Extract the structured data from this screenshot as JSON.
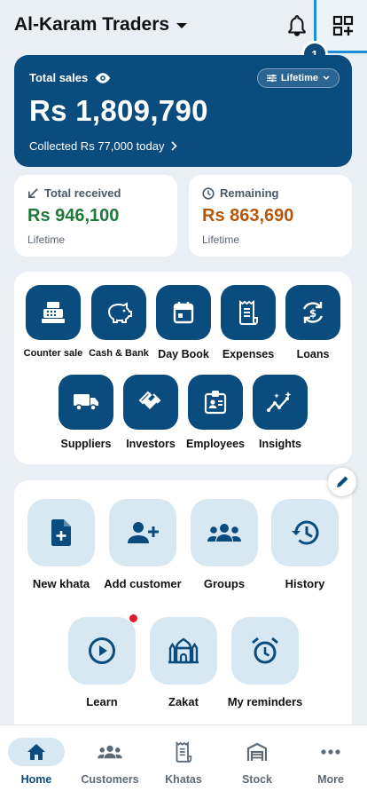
{
  "header": {
    "business_name": "Al-Karam Traders",
    "qr_badge_count": "1"
  },
  "sales": {
    "label": "Total sales",
    "period": "Lifetime",
    "amount": "Rs 1,809,790",
    "collected": "Collected Rs 77,000 today"
  },
  "stats": {
    "received": {
      "title": "Total received",
      "value": "Rs 946,100",
      "sub": "Lifetime",
      "color": "#1f7a3a"
    },
    "remaining": {
      "title": "Remaining",
      "value": "Rs 863,690",
      "sub": "Lifetime",
      "color": "#b5560b"
    }
  },
  "tools": [
    {
      "label": "Counter sale",
      "icon": "cash-register-icon"
    },
    {
      "label": "Cash & Bank",
      "icon": "piggy-bank-icon"
    },
    {
      "label": "Day Book",
      "icon": "calendar-icon"
    },
    {
      "label": "Expenses",
      "icon": "receipt-icon"
    },
    {
      "label": "Loans",
      "icon": "loan-icon"
    },
    {
      "label": "Suppliers",
      "icon": "truck-icon"
    },
    {
      "label": "Investors",
      "icon": "handshake-icon"
    },
    {
      "label": "Employees",
      "icon": "id-badge-icon"
    },
    {
      "label": "Insights",
      "icon": "insights-icon"
    }
  ],
  "actions": [
    {
      "label": "New khata",
      "icon": "new-file-icon"
    },
    {
      "label": "Add customer",
      "icon": "add-person-icon"
    },
    {
      "label": "Groups",
      "icon": "groups-icon"
    },
    {
      "label": "History",
      "icon": "history-icon"
    },
    {
      "label": "Learn",
      "icon": "play-icon"
    },
    {
      "label": "Zakat",
      "icon": "mosque-icon"
    },
    {
      "label": "My reminders",
      "icon": "alarm-icon"
    }
  ],
  "nav": [
    {
      "label": "Home",
      "icon": "home-icon",
      "active": true
    },
    {
      "label": "Customers",
      "icon": "customers-icon"
    },
    {
      "label": "Khatas",
      "icon": "ledger-icon"
    },
    {
      "label": "Stock",
      "icon": "warehouse-icon"
    },
    {
      "label": "More",
      "icon": "more-icon"
    }
  ],
  "colors": {
    "primary": "#0b4c7e",
    "tile_light": "#d8e8f2",
    "background": "#e9eff4",
    "alert_dot": "#e01b2b"
  }
}
